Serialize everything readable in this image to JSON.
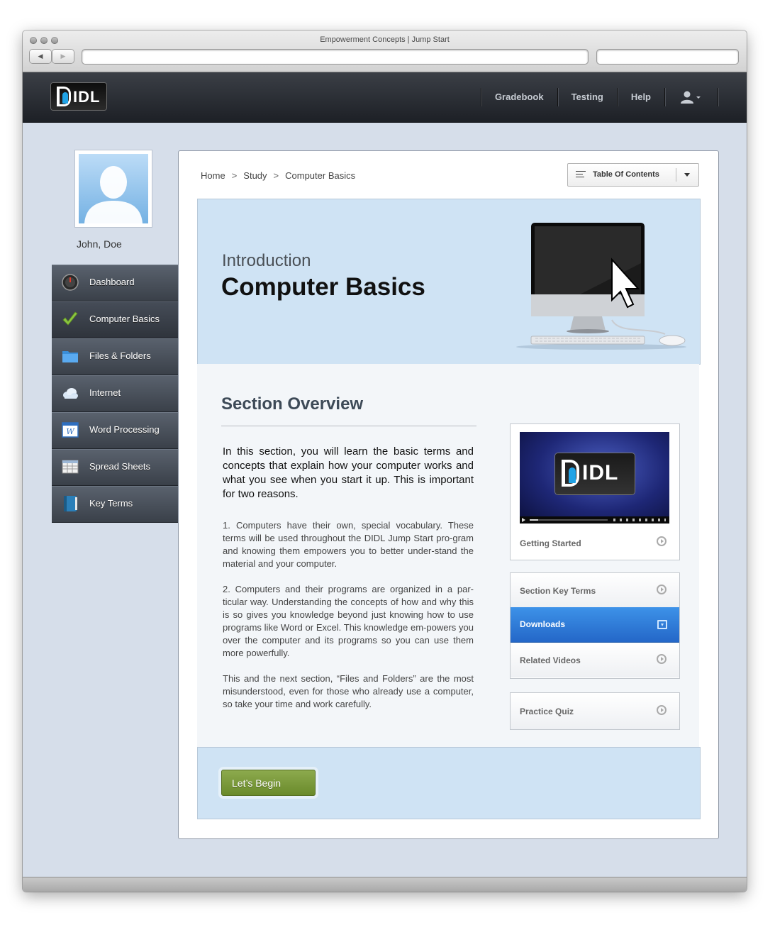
{
  "window": {
    "title": "Empowerment Concepts | Jump Start",
    "back_icon": "◀",
    "forward_icon": "▶"
  },
  "header": {
    "logo_text": "IDL",
    "nav": [
      "Gradebook",
      "Testing",
      "Help"
    ],
    "user_icon": "user-icon"
  },
  "profile": {
    "name": "John, Doe"
  },
  "sidebar": {
    "items": [
      {
        "label": "Dashboard",
        "icon": "dashboard-gauge-icon"
      },
      {
        "label": "Computer Basics",
        "icon": "checkmark-icon",
        "active": true
      },
      {
        "label": "Files & Folders",
        "icon": "folder-icon"
      },
      {
        "label": "Internet",
        "icon": "cloud-icon"
      },
      {
        "label": "Word Processing",
        "icon": "word-document-icon"
      },
      {
        "label": "Spread Sheets",
        "icon": "spreadsheet-icon"
      },
      {
        "label": "Key Terms",
        "icon": "book-icon"
      }
    ]
  },
  "breadcrumb": {
    "items": [
      "Home",
      "Study",
      "Computer Basics"
    ],
    "separator": ">"
  },
  "toc": {
    "label": "Table Of Contents"
  },
  "hero": {
    "subtitle": "Introduction",
    "title": "Computer Basics"
  },
  "overview": {
    "title": "Section Overview",
    "lead": "In this section, you will learn the basic terms and concepts that explain how your computer works and what you see when you start it up. This is important for two reasons.",
    "p1": "1. Computers have their own, special vocabulary. These terms will be used throughout the DIDL Jump Start pro-gram and knowing them empowers you to better under-stand the material and your computer.",
    "p2": "2. Computers and their programs are organized in a par-ticular way. Understanding the concepts of how and why this is so gives you knowledge beyond just knowing how to use programs like Word or Excel. This knowledge em-powers you over the computer and its programs so you can use them more powerfully.",
    "p3": "This and the next section, “Files and Folders” are the most misunderstood, even for those who already use a computer, so take your time and work carefully."
  },
  "video": {
    "logo_text": "IDL",
    "label": "Getting Started"
  },
  "links": {
    "key_terms": "Section Key Terms",
    "downloads": "Downloads",
    "related": "Related Videos",
    "quiz": "Practice Quiz"
  },
  "cta": {
    "label": "Let’s Begin"
  },
  "colors": {
    "accent_blue": "#2f7ad8",
    "begin_green": "#7c9a3c",
    "hero_bg": "#cfe3f4",
    "page_bg": "#d6deea"
  }
}
